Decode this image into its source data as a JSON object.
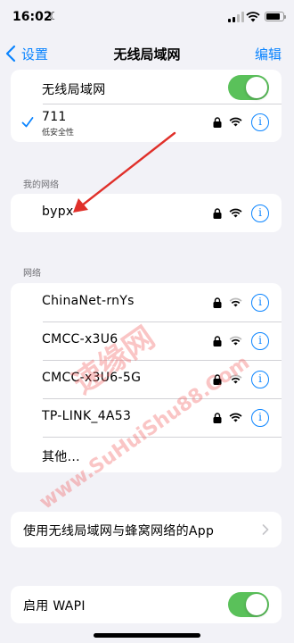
{
  "status_bar": {
    "time": "16:02"
  },
  "nav": {
    "back_label": "设置",
    "title": "无线局域网",
    "edit_label": "编辑"
  },
  "wlan_group": {
    "toggle_label": "无线局域网",
    "toggle_on": true,
    "connected_network": {
      "name": "711",
      "subtext": "低安全性"
    }
  },
  "my_networks": {
    "header": "我的网络",
    "items": [
      {
        "name": "bypx"
      }
    ]
  },
  "networks": {
    "header": "网络",
    "items": [
      {
        "name": "ChinaNet-rnYs"
      },
      {
        "name": "CMCC-x3U6"
      },
      {
        "name": "CMCC-x3U6-5G"
      },
      {
        "name": "TP-LINK_4A53"
      }
    ],
    "other_label": "其他..."
  },
  "app_settings": {
    "label": "使用无线局域网与蜂窝网络的App"
  },
  "wapi": {
    "label": "启用 WAPI",
    "toggle_on": true
  },
  "watermark": {
    "line1": "速缘网",
    "line2": "www.SuHuiShu88.Com"
  },
  "colors": {
    "accent": "#0a84ff",
    "toggle_on": "#5ac15a",
    "arrow": "#e0302a",
    "background": "#f2f2f7"
  },
  "info_glyph": "i"
}
